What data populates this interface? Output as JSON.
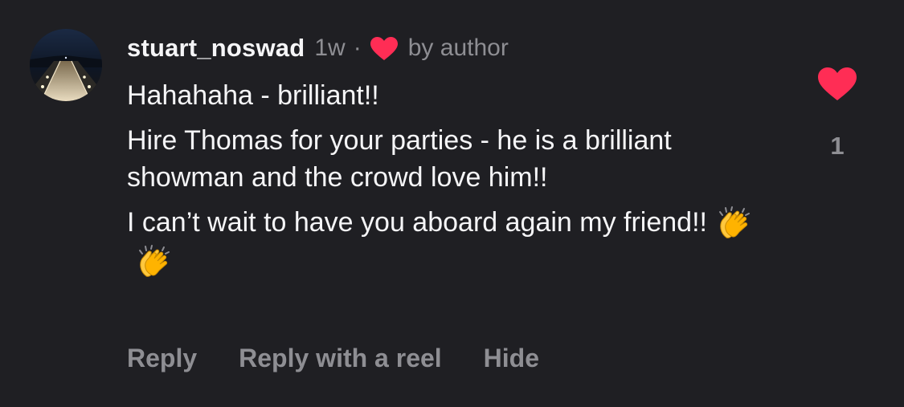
{
  "comment": {
    "username": "stuart_noswad",
    "timestamp": "1w",
    "separator": "·",
    "author_label": "by author",
    "paragraphs": [
      "Hahahaha - brilliant!!",
      "Hire Thomas for your parties - he is a brilliant showman and the crowd love him!!",
      "I can’t wait to have you aboard again my friend!!"
    ],
    "emojis": [
      "clapping-hands-emoji",
      "clapping-hands-emoji"
    ],
    "like_count": "1",
    "colors": {
      "background": "#1f1f23",
      "text": "#f5f5f7",
      "muted": "#8e8e93",
      "heart": "#ff2d55"
    }
  },
  "actions": {
    "reply": "Reply",
    "reply_with_reel": "Reply with a reel",
    "hide": "Hide"
  }
}
